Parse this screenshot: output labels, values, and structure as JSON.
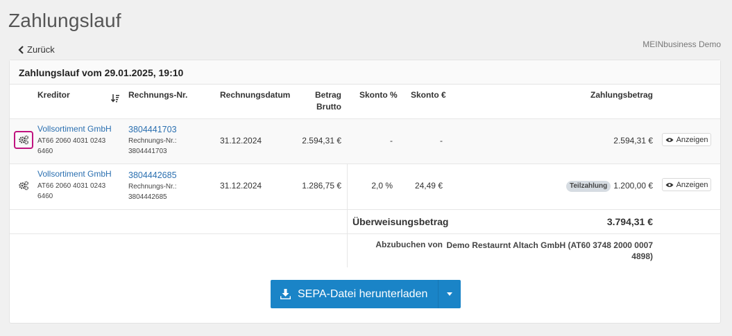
{
  "page": {
    "title": "Zahlungslauf",
    "back_label": "Zurück",
    "company": "MEINbusiness Demo"
  },
  "panel": {
    "title": "Zahlungslauf vom 29.01.2025, 19:10"
  },
  "table": {
    "headers": {
      "kreditor": "Kreditor",
      "rechnungs_nr": "Rechnungs-Nr.",
      "rechnungsdatum": "Rechnungsdatum",
      "betrag_line1": "Betrag",
      "betrag_line2": "Brutto",
      "skonto_pct": "Skonto %",
      "skonto_eur": "Skonto €",
      "zahlungsbetrag": "Zahlungsbetrag"
    },
    "rows": [
      {
        "kreditor": "Vollsortiment GmbH",
        "iban_line1": "AT66 2060 4031 0243",
        "iban_line2": "6460",
        "rechnung": "3804441703",
        "rechnung_sub1": "Rechnungs-Nr.:",
        "rechnung_sub2": "3804441703",
        "datum": "31.12.2024",
        "betrag": "2.594,31 €",
        "skonto_pct": "-",
        "skonto_eur": "-",
        "badge": "",
        "zahlungsbetrag": "2.594,31 €",
        "action": "Anzeigen"
      },
      {
        "kreditor": "Vollsortiment GmbH",
        "iban_line1": "AT66 2060 4031 0243",
        "iban_line2": "6460",
        "rechnung": "3804442685",
        "rechnung_sub1": "Rechnungs-Nr.:",
        "rechnung_sub2": "3804442685",
        "datum": "31.12.2024",
        "betrag": "1.286,75 €",
        "skonto_pct": "2,0 %",
        "skonto_eur": "24,49 €",
        "badge": "Teilzahlung",
        "zahlungsbetrag": "1.200,00 €",
        "action": "Anzeigen"
      }
    ],
    "summary": {
      "label": "Überweisungsbetrag",
      "value": "3.794,31 €"
    },
    "debit": {
      "label": "Abzubuchen von",
      "value_line1": "Demo Restaurnt Altach GmbH (AT60 3748 2000 0007",
      "value_line2": "4898)"
    }
  },
  "sepa": {
    "label": "SEPA-Datei herunterladen"
  },
  "colors": {
    "accent": "#1a84c7",
    "link": "#2a6fb0",
    "highlight": "#c0137f"
  }
}
